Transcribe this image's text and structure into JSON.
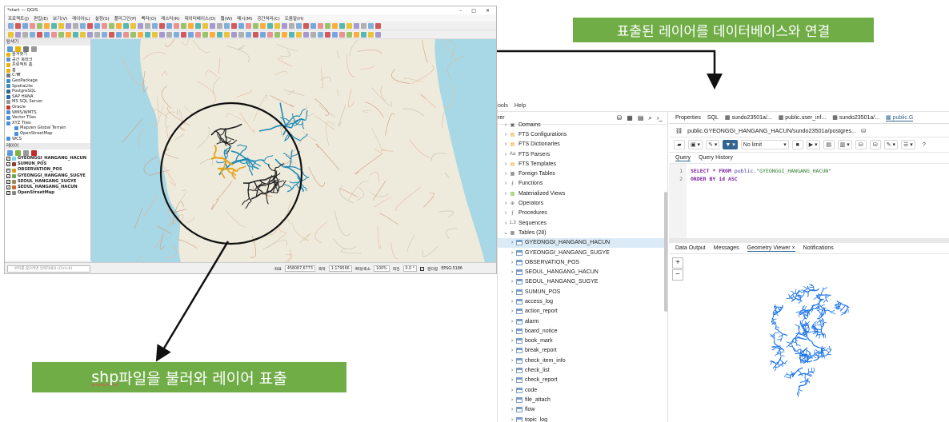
{
  "qgis": {
    "title": "*start — QGIS",
    "menu": [
      "프로젝트(J)",
      "편집(E)",
      "보기(V)",
      "레이어(L)",
      "설정(S)",
      "플러그인(P)",
      "벡터(O)",
      "래스터(R)",
      "데이터베이스(D)",
      "웹(W)",
      "메시(M)",
      "공간처리(C)",
      "도움말(H)"
    ],
    "browser_title": "탐색기",
    "browser_items": [
      {
        "label": "즐겨찾기",
        "color": "#e8b400"
      },
      {
        "label": "공간 북마크",
        "color": "#5b8fd6"
      },
      {
        "label": "프로젝트 홈",
        "color": "#e8b400"
      },
      {
        "label": "홈",
        "color": "#e8b400"
      },
      {
        "label": "C:₩",
        "color": "#777777"
      },
      {
        "label": "GeoPackage",
        "color": "#3a8fc7"
      },
      {
        "label": "SpatiaLite",
        "color": "#3a8fc7"
      },
      {
        "label": "PostgreSQL",
        "color": "#336791"
      },
      {
        "label": "SAP HANA",
        "color": "#2b6cb0"
      },
      {
        "label": "MS SQL Server",
        "color": "#999999"
      },
      {
        "label": "Oracle",
        "color": "#c0392b"
      },
      {
        "label": "WMS/WMTS",
        "color": "#4a90d9"
      },
      {
        "label": "Vector Tiles",
        "color": "#4a90d9"
      },
      {
        "label": "XYZ Tiles",
        "color": "#4a90d9"
      },
      {
        "label": "Mapzen Global Terrain",
        "color": "#4a90d9"
      },
      {
        "label": "OpenStreetMap",
        "color": "#4a90d9"
      },
      {
        "label": "WCS",
        "color": "#4a90d9"
      }
    ],
    "layers_title": "레이어",
    "layers": [
      {
        "label": "GYEONGGI_HANGANG_HACUN",
        "color": "#7fd3e8"
      },
      {
        "label": "SUMUN_POS",
        "color": "#8e3b2a"
      },
      {
        "label": "OBSERVATION_POS",
        "color": "#d4a017"
      },
      {
        "label": "GYEONGGI_HANGANG_SUGYE",
        "color": "#6aa84f"
      },
      {
        "label": "SEOUL_HANGANG_SUGYE",
        "color": "#9b8b5a"
      },
      {
        "label": "SEOUL_HANGANG_HACUN",
        "color": "#c96a2a"
      },
      {
        "label": "OpenStreetMap",
        "color": "#888888"
      }
    ],
    "status": {
      "search_placeholder": "위치를 찾으려면 입력하세요 (Ctrl+K)",
      "coord_label": "좌표",
      "coord": "458087,6773",
      "scale_label": "축척",
      "scale": "1:179566",
      "magnifier_label": "확대/축소",
      "magnifier": "100%",
      "rotation_label": "회전",
      "rotation": "0.0 °",
      "render_label": "렌더링",
      "crs": "EPSG:5186"
    }
  },
  "banners": {
    "top": "표출된 레이어를 데이터베이스와 연결",
    "bottom_prefix": "shp",
    "bottom_rest": "파일을 불러와 레이어 표출"
  },
  "pgadmin": {
    "menu": [
      "ools",
      "Help"
    ],
    "left_header": "rer",
    "objects": [
      {
        "label": "Domains",
        "icon": "dom"
      },
      {
        "label": "FTS Configurations",
        "icon": "fts"
      },
      {
        "label": "FTS Dictionaries",
        "icon": "fts"
      },
      {
        "label": "FTS Parsers",
        "icon": "aa"
      },
      {
        "label": "FTS Templates",
        "icon": "fts"
      },
      {
        "label": "Foreign Tables",
        "icon": "tbl"
      },
      {
        "label": "Functions",
        "icon": "fn"
      },
      {
        "label": "Materialized Views",
        "icon": "mv"
      },
      {
        "label": "Operators",
        "icon": "op"
      },
      {
        "label": "Procedures",
        "icon": "fn"
      },
      {
        "label": "Sequences",
        "icon": "seq"
      },
      {
        "label": "Tables (28)",
        "icon": "tbl"
      }
    ],
    "tables": [
      "GYEONGGI_HANGANG_HACUN",
      "GYEONGGI_HANGANG_SUGYE",
      "OBSERVATION_POS",
      "SEOUL_HANGANG_HACUN",
      "SEOUL_HANGANG_SUGYE",
      "SUMUN_POS",
      "access_log",
      "action_report",
      "alarm",
      "board_notice",
      "book_mark",
      "break_report",
      "check_item_info",
      "check_list",
      "check_report",
      "code",
      "file_attach",
      "flow",
      "topic_log"
    ],
    "tabs": [
      "Properties",
      "SQL",
      "sundo23501a/...",
      "public.user_inf...",
      "sundo23501a/...",
      "public.G"
    ],
    "path": "public.GYEONGGI_HANGANG_HACUN/sundo23501a/postgres...",
    "limit": "No limit",
    "query_tabs": [
      "Query",
      "Query History"
    ],
    "sql_lines": [
      {
        "n": "1",
        "a": "SELECT * FROM ",
        "b": "public.",
        "c": "\"GYEONGGI_HANGANG_HACUN\""
      },
      {
        "n": "2",
        "a": "ORDER BY id ASC",
        "b": "",
        "c": ""
      }
    ],
    "output_tabs": [
      "Data Output",
      "Messages",
      "Geometry Viewer",
      "×",
      "Notifications"
    ],
    "zoom_in": "+",
    "zoom_out": "−",
    "geometry_color": "#1a73e8"
  },
  "map_colors": {
    "sea": "#a8d7e5",
    "land": "#eeeadc",
    "hacun": "#1e8ab4",
    "hacun_dark": "#222222",
    "sugye": "#e8a317",
    "circle": "#111111"
  }
}
